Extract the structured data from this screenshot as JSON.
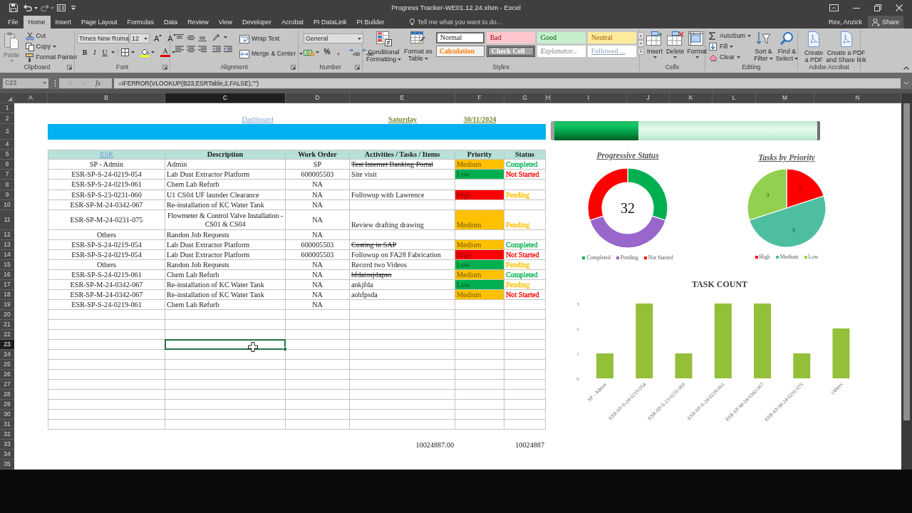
{
  "window": {
    "title": "Progress Tracker-WE01.12.24.xlsm - Excel"
  },
  "ribbon_tabs": [
    {
      "label": "File",
      "selected": false
    },
    {
      "label": "Home",
      "selected": true
    },
    {
      "label": "Insert",
      "selected": false
    },
    {
      "label": "Page Layout",
      "selected": false
    },
    {
      "label": "Formulas",
      "selected": false
    },
    {
      "label": "Data",
      "selected": false
    },
    {
      "label": "Review",
      "selected": false
    },
    {
      "label": "View",
      "selected": false
    },
    {
      "label": "Developer",
      "selected": false
    },
    {
      "label": "Acrobat",
      "selected": false
    },
    {
      "label": "PI DataLink",
      "selected": false
    },
    {
      "label": "PI Builder",
      "selected": false
    }
  ],
  "tell_me": {
    "placeholder": "Tell me what you want to do..."
  },
  "account": {
    "user": "Rex, Anzick",
    "share": "Share"
  },
  "ribbon": {
    "clipboard": {
      "label": "Clipboard",
      "paste": {
        "label": "Paste",
        "disabled": true
      },
      "actions": [
        "Cut",
        "Copy",
        "Format Painter"
      ]
    },
    "font": {
      "label": "Font",
      "font_name": "Times New Roma",
      "font_size": "12",
      "size_buttons": [
        "A",
        "A"
      ],
      "style_buttons": [
        "B",
        "I",
        "U"
      ],
      "font_color": "A"
    },
    "alignment": {
      "label": "Alignment",
      "wrap_text": "Wrap Text",
      "merge": "Merge & Center"
    },
    "number": {
      "label": "Number",
      "format": "General",
      "symbols": [
        "%",
        ","
      ]
    },
    "styles": {
      "label": "Styles",
      "commands": [
        [
          "Conditional",
          "Formatting"
        ],
        [
          "Format as",
          "Table"
        ]
      ],
      "gallery": [
        {
          "label": "Normal",
          "kind": "normal"
        },
        {
          "label": "Bad",
          "kind": "bad"
        },
        {
          "label": "Good",
          "kind": "good"
        },
        {
          "label": "Neutral",
          "kind": "neutral"
        },
        {
          "label": "Calculation",
          "kind": "calculation"
        },
        {
          "label": "Check Cell",
          "kind": "check"
        },
        {
          "label": "Explanator...",
          "kind": "explanatory"
        },
        {
          "label": "Followed ...",
          "kind": "followed"
        }
      ]
    },
    "cells": {
      "label": "Cells",
      "commands": [
        "Insert",
        "Delete",
        "Format"
      ]
    },
    "editing": {
      "label": "Editing",
      "small": [
        "AutoSum",
        "Fill",
        "Clear"
      ],
      "large": [
        [
          "Sort &",
          "Filter"
        ],
        [
          "Find &",
          "Select"
        ]
      ]
    },
    "acrobat": {
      "label": "Adobe Acrobat",
      "commands": [
        [
          "Create",
          "a PDF"
        ],
        [
          "Create a PDF",
          "and Share link"
        ]
      ]
    }
  },
  "formula_bar": {
    "name_box": "C23",
    "function_label": "fx",
    "formula": "=IFERROR(VLOOKUP(B23,ESRTable,2,FALSE),\"\")"
  },
  "columns": [
    {
      "label": "A",
      "selected": false
    },
    {
      "label": "B",
      "selected": false
    },
    {
      "label": "C",
      "selected": true
    },
    {
      "label": "D",
      "selected": false
    },
    {
      "label": "E",
      "selected": false
    },
    {
      "label": "F",
      "selected": false
    },
    {
      "label": "G",
      "selected": false
    },
    {
      "label": "H",
      "selected": false
    },
    {
      "label": "I",
      "selected": false
    },
    {
      "label": "J",
      "selected": false
    },
    {
      "label": "K",
      "selected": false
    },
    {
      "label": "L",
      "selected": false
    },
    {
      "label": "M",
      "selected": false
    },
    {
      "label": "N",
      "selected": false
    }
  ],
  "row_headers": [
    {
      "label": "1",
      "selected": false
    },
    {
      "label": "2",
      "selected": false
    },
    {
      "label": "3",
      "selected": false
    },
    {
      "label": "4",
      "selected": false
    },
    {
      "label": "5",
      "selected": false
    },
    {
      "label": "6",
      "selected": false
    },
    {
      "label": "7",
      "selected": false
    },
    {
      "label": "8",
      "selected": false
    },
    {
      "label": "9",
      "selected": false
    },
    {
      "label": "10",
      "selected": false
    },
    {
      "label": "11",
      "selected": false
    },
    {
      "label": "12",
      "selected": false
    },
    {
      "label": "13",
      "selected": false
    },
    {
      "label": "14",
      "selected": false
    },
    {
      "label": "15",
      "selected": false
    },
    {
      "label": "16",
      "selected": false
    },
    {
      "label": "17",
      "selected": false
    },
    {
      "label": "18",
      "selected": false
    },
    {
      "label": "19",
      "selected": false
    },
    {
      "label": "20",
      "selected": false
    },
    {
      "label": "21",
      "selected": false
    },
    {
      "label": "22",
      "selected": false
    },
    {
      "label": "23",
      "selected": true
    },
    {
      "label": "24",
      "selected": false
    },
    {
      "label": "25",
      "selected": false
    },
    {
      "label": "26",
      "selected": false
    },
    {
      "label": "27",
      "selected": false
    },
    {
      "label": "28",
      "selected": false
    },
    {
      "label": "29",
      "selected": false
    },
    {
      "label": "30",
      "selected": false
    },
    {
      "label": "31",
      "selected": false
    },
    {
      "label": "32",
      "selected": false
    },
    {
      "label": "33",
      "selected": false
    },
    {
      "label": "34",
      "selected": false
    },
    {
      "label": "35",
      "selected": false
    }
  ],
  "sheet": {
    "dashboard_link": "Dashboard",
    "day": "Saturday",
    "date": "30/11/2024",
    "progress": {
      "level": 0.32
    },
    "table": {
      "columns": [
        {
          "label": "ESR",
          "kind": "link"
        },
        {
          "label": "Description",
          "kind": "text"
        },
        {
          "label": "Work Order",
          "kind": "text"
        },
        {
          "label": "Activities / Tasks / Items",
          "kind": "text"
        },
        {
          "label": "Priority",
          "kind": "text"
        },
        {
          "label": "Status",
          "kind": "text"
        }
      ],
      "rows": [
        {
          "esr": "SP - Admin",
          "description": "Admin",
          "work_order": "SP",
          "activity": "Test Internet Banking Portal",
          "struck": true,
          "priority": {
            "text": "Medium",
            "color": "#ffc000"
          },
          "status": {
            "text": "Completed",
            "color": "#00b050"
          }
        },
        {
          "esr": "ESR-SP-S-24-0219-054",
          "description": "Lab Dust Extractor Platform",
          "work_order": "600005503",
          "activity": "Site visit",
          "struck": false,
          "priority": {
            "text": "Low",
            "color": "#00b050"
          },
          "status": {
            "text": "Not Started",
            "color": "#ff0000"
          }
        },
        {
          "esr": "ESR-SP-S-24-0219-061",
          "description": "Chem Lab Refurb",
          "work_order": "NA"
        },
        {
          "esr": "ESR-SP-S-23-0231-060",
          "description": "U1 CS04 UF launder Clearance",
          "work_order": "NA",
          "activity": "Followup with Lawrence",
          "struck": false,
          "priority": {
            "text": "High",
            "color": "#ff0000"
          },
          "status": {
            "text": "Pending",
            "color": "#ffc000"
          }
        },
        {
          "esr": "ESR-SP-M-24-0342-067",
          "description": "Re-installation of KC Water Tank",
          "work_order": "NA"
        },
        {
          "esr": "ESR-SP-M-24-0231-075",
          "description": "Flowmeter & Control Valve Installation - CS01 & CS04",
          "work_order": "NA",
          "activity": "Review drafting drawing",
          "struck": false,
          "priority": {
            "text": "Medium",
            "color": "#ffc000"
          },
          "status": {
            "text": "Pending",
            "color": "#ffc000"
          }
        },
        {
          "esr": "Others",
          "description": "Randon Job Requests",
          "work_order": "NA"
        },
        {
          "esr": "ESR-SP-S-24-0219-054",
          "description": "Lab Dust Extractor Platform",
          "work_order": "600005503",
          "activity": "Costing in SAP",
          "struck": true,
          "priority": {
            "text": "Medium",
            "color": "#ffc000"
          },
          "status": {
            "text": "Completed",
            "color": "#00b050"
          }
        },
        {
          "esr": "ESR-SP-S-24-0219-054",
          "description": "Lab Dust Extractor Platform",
          "work_order": "600005503",
          "activity": "Followup on FA28 Fabrication",
          "struck": false,
          "priority": {
            "text": "High",
            "color": "#ff0000"
          },
          "status": {
            "text": "Not Started",
            "color": "#ff0000"
          }
        },
        {
          "esr": "Others",
          "description": "Randon Job Requests",
          "work_order": "NA",
          "activity": "Record two Videos",
          "struck": false,
          "priority": {
            "text": "Low",
            "color": "#00b050"
          },
          "status": {
            "text": "Pending",
            "color": "#ffc000"
          }
        },
        {
          "esr": "ESR-SP-S-24-0219-061",
          "description": "Chem Lab Refurb",
          "work_order": "NA",
          "activity": "hfdaiosjdapso",
          "struck": true,
          "priority": {
            "text": "Medium",
            "color": "#ffc000"
          },
          "status": {
            "text": "Completed",
            "color": "#00b050"
          }
        },
        {
          "esr": "ESR-SP-M-24-0342-067",
          "description": "Re-installation of KC Water Tank",
          "work_order": "NA",
          "activity": "ankjfda",
          "struck": false,
          "priority": {
            "text": "Low",
            "color": "#00b050"
          },
          "status": {
            "text": "Pending",
            "color": "#ffc000"
          }
        },
        {
          "esr": "ESR-SP-M-24-0342-067",
          "description": "Re-installation of KC Water Tank",
          "work_order": "NA",
          "activity": "aohfpsda",
          "struck": false,
          "priority": {
            "text": "Medium",
            "color": "#ffc000"
          },
          "status": {
            "text": "Not Started",
            "color": "#ff0000"
          }
        },
        {
          "esr": "ESR-SP-S-24-0219-061",
          "description": "Chem Lab Refurb",
          "work_order": "NA"
        }
      ]
    },
    "totals": [
      "10024887.00",
      "10024887"
    ]
  },
  "status_chart": {
    "title": "Progressive Status",
    "center_label": "32",
    "legend": [
      {
        "label": "Completed",
        "color": "#00b050"
      },
      {
        "label": "Pending",
        "color": "#9966cc"
      },
      {
        "label": "Not Started",
        "color": "#ff0000"
      }
    ]
  },
  "priority_chart": {
    "legend_markers": [
      {
        "color": "#ff0000"
      },
      {
        "color": "#4dbfa0"
      },
      {
        "color": "#92d050"
      }
    ],
    "chart_data": {
      "type": "pie",
      "title": "Tasks by Priority",
      "categories": [
        "High",
        "Medium",
        "Low"
      ],
      "values": [
        2,
        5,
        3
      ],
      "data_labels": true,
      "legend": "bottom"
    }
  },
  "task_chart": {
    "chart_data": {
      "type": "bar",
      "title": "TASK COUNT",
      "categories": [
        "SP - Admin",
        "ESR-SP-S-24-0219-054",
        "ESR-SP-S-23-0231-060",
        "ESR-SP-S-24-0219-061",
        "ESR-SP-M-24-0342-067",
        "ESR-SP-M-24-0231-075",
        "Others"
      ],
      "values": [
        1,
        3,
        1,
        3,
        3,
        1,
        2
      ],
      "ylim": [
        0,
        3
      ],
      "yticks": [
        0,
        1,
        2,
        3
      ]
    }
  }
}
